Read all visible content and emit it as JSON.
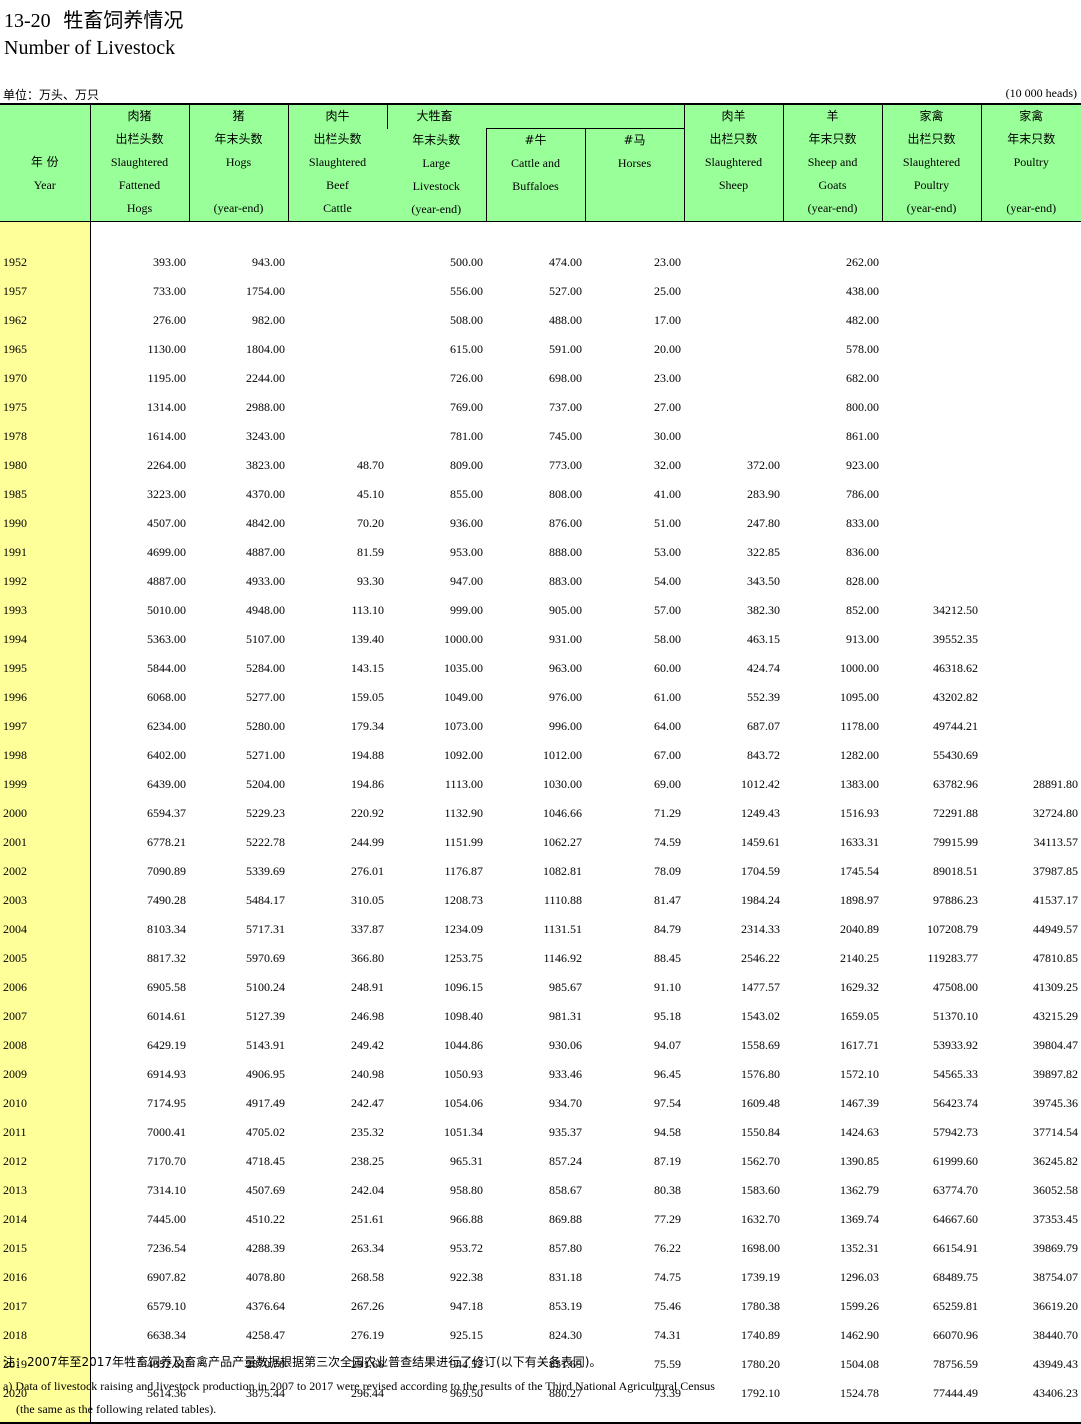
{
  "header": {
    "number": "13-20",
    "title_zh": "牲畜饲养情况",
    "title_en": "Number of Livestock",
    "unit_zh": "单位：万头、万只",
    "unit_en": "(10 000 heads)"
  },
  "columns": {
    "year": {
      "zh": "年 份",
      "en": "Year"
    },
    "fattened_hogs": {
      "zh1": "肉猪",
      "zh2": "出栏头数",
      "en1": "Slaughtered",
      "en2": "Fattened",
      "en3": "Hogs"
    },
    "hogs": {
      "zh1": "猪",
      "zh2": "年末头数",
      "en1": "Hogs",
      "en2": "",
      "en3": "(year-end)"
    },
    "beef": {
      "zh1": "肉牛",
      "zh2": "出栏头数",
      "en1": "Slaughtered",
      "en2": "Beef",
      "en3": "Cattle"
    },
    "large_livestock": {
      "zh1": "大牲畜",
      "zh2": "年末头数",
      "en1": "Large",
      "en2": "Livestock",
      "en3": "(year-end)"
    },
    "cattle": {
      "zh": "#牛",
      "en1": "Cattle and",
      "en2": "Buffaloes"
    },
    "horses": {
      "zh": "#马",
      "en1": "Horses"
    },
    "sheep_slaughtered": {
      "zh1": "肉羊",
      "zh2": "出栏只数",
      "en1": "Slaughtered",
      "en2": "Sheep",
      "en3": ""
    },
    "sheep_goats": {
      "zh1": "羊",
      "zh2": "年末只数",
      "en1": "Sheep and",
      "en2": "Goats",
      "en3": "(year-end)"
    },
    "poultry_slaughtered": {
      "zh1": "家禽",
      "zh2": "出栏只数",
      "en1": "Slaughtered",
      "en2": "Poultry",
      "en3": "(year-end)"
    },
    "poultry": {
      "zh1": "家禽",
      "zh2": "年末只数",
      "en1": "Poultry",
      "en2": "",
      "en3": "(year-end)"
    }
  },
  "rows": [
    [
      "1952",
      "393.00",
      "943.00",
      "",
      "500.00",
      "474.00",
      "23.00",
      "",
      "262.00",
      "",
      ""
    ],
    [
      "1957",
      "733.00",
      "1754.00",
      "",
      "556.00",
      "527.00",
      "25.00",
      "",
      "438.00",
      "",
      ""
    ],
    [
      "1962",
      "276.00",
      "982.00",
      "",
      "508.00",
      "488.00",
      "17.00",
      "",
      "482.00",
      "",
      ""
    ],
    [
      "1965",
      "1130.00",
      "1804.00",
      "",
      "615.00",
      "591.00",
      "20.00",
      "",
      "578.00",
      "",
      ""
    ],
    [
      "1970",
      "1195.00",
      "2244.00",
      "",
      "726.00",
      "698.00",
      "23.00",
      "",
      "682.00",
      "",
      ""
    ],
    [
      "1975",
      "1314.00",
      "2988.00",
      "",
      "769.00",
      "737.00",
      "27.00",
      "",
      "800.00",
      "",
      ""
    ],
    [
      "1978",
      "1614.00",
      "3243.00",
      "",
      "781.00",
      "745.00",
      "30.00",
      "",
      "861.00",
      "",
      ""
    ],
    [
      "1980",
      "2264.00",
      "3823.00",
      "48.70",
      "809.00",
      "773.00",
      "32.00",
      "372.00",
      "923.00",
      "",
      ""
    ],
    [
      "1985",
      "3223.00",
      "4370.00",
      "45.10",
      "855.00",
      "808.00",
      "41.00",
      "283.90",
      "786.00",
      "",
      ""
    ],
    [
      "1990",
      "4507.00",
      "4842.00",
      "70.20",
      "936.00",
      "876.00",
      "51.00",
      "247.80",
      "833.00",
      "",
      ""
    ],
    [
      "1991",
      "4699.00",
      "4887.00",
      "81.59",
      "953.00",
      "888.00",
      "53.00",
      "322.85",
      "836.00",
      "",
      ""
    ],
    [
      "1992",
      "4887.00",
      "4933.00",
      "93.30",
      "947.00",
      "883.00",
      "54.00",
      "343.50",
      "828.00",
      "",
      ""
    ],
    [
      "1993",
      "5010.00",
      "4948.00",
      "113.10",
      "999.00",
      "905.00",
      "57.00",
      "382.30",
      "852.00",
      "34212.50",
      ""
    ],
    [
      "1994",
      "5363.00",
      "5107.00",
      "139.40",
      "1000.00",
      "931.00",
      "58.00",
      "463.15",
      "913.00",
      "39552.35",
      ""
    ],
    [
      "1995",
      "5844.00",
      "5284.00",
      "143.15",
      "1035.00",
      "963.00",
      "60.00",
      "424.74",
      "1000.00",
      "46318.62",
      ""
    ],
    [
      "1996",
      "6068.00",
      "5277.00",
      "159.05",
      "1049.00",
      "976.00",
      "61.00",
      "552.39",
      "1095.00",
      "43202.82",
      ""
    ],
    [
      "1997",
      "6234.00",
      "5280.00",
      "179.34",
      "1073.00",
      "996.00",
      "64.00",
      "687.07",
      "1178.00",
      "49744.21",
      ""
    ],
    [
      "1998",
      "6402.00",
      "5271.00",
      "194.88",
      "1092.00",
      "1012.00",
      "67.00",
      "843.72",
      "1282.00",
      "55430.69",
      ""
    ],
    [
      "1999",
      "6439.00",
      "5204.00",
      "194.86",
      "1113.00",
      "1030.00",
      "69.00",
      "1012.42",
      "1383.00",
      "63782.96",
      "28891.80"
    ],
    [
      "2000",
      "6594.37",
      "5229.23",
      "220.92",
      "1132.90",
      "1046.66",
      "71.29",
      "1249.43",
      "1516.93",
      "72291.88",
      "32724.80"
    ],
    [
      "2001",
      "6778.21",
      "5222.78",
      "244.99",
      "1151.99",
      "1062.27",
      "74.59",
      "1459.61",
      "1633.31",
      "79915.99",
      "34113.57"
    ],
    [
      "2002",
      "7090.89",
      "5339.69",
      "276.01",
      "1176.87",
      "1082.81",
      "78.09",
      "1704.59",
      "1745.54",
      "89018.51",
      "37987.85"
    ],
    [
      "2003",
      "7490.28",
      "5484.17",
      "310.05",
      "1208.73",
      "1110.88",
      "81.47",
      "1984.24",
      "1898.97",
      "97886.23",
      "41537.17"
    ],
    [
      "2004",
      "8103.34",
      "5717.31",
      "337.87",
      "1234.09",
      "1131.51",
      "84.79",
      "2314.33",
      "2040.89",
      "107208.79",
      "44949.57"
    ],
    [
      "2005",
      "8817.32",
      "5970.69",
      "366.80",
      "1253.75",
      "1146.92",
      "88.45",
      "2546.22",
      "2140.25",
      "119283.77",
      "47810.85"
    ],
    [
      "2006",
      "6905.58",
      "5100.24",
      "248.91",
      "1096.15",
      "985.67",
      "91.10",
      "1477.57",
      "1629.32",
      "47508.00",
      "41309.25"
    ],
    [
      "2007",
      "6014.61",
      "5127.39",
      "246.98",
      "1098.40",
      "981.31",
      "95.18",
      "1543.02",
      "1659.05",
      "51370.10",
      "43215.29"
    ],
    [
      "2008",
      "6429.19",
      "5143.91",
      "249.42",
      "1044.86",
      "930.06",
      "94.07",
      "1558.69",
      "1617.71",
      "53933.92",
      "39804.47"
    ],
    [
      "2009",
      "6914.93",
      "4906.95",
      "240.98",
      "1050.93",
      "933.46",
      "96.45",
      "1576.80",
      "1572.10",
      "54565.33",
      "39897.82"
    ],
    [
      "2010",
      "7174.95",
      "4917.49",
      "242.47",
      "1054.06",
      "934.70",
      "97.54",
      "1609.48",
      "1467.39",
      "56423.74",
      "39745.36"
    ],
    [
      "2011",
      "7000.41",
      "4705.02",
      "235.32",
      "1051.34",
      "935.37",
      "94.58",
      "1550.84",
      "1424.63",
      "57942.73",
      "37714.54"
    ],
    [
      "2012",
      "7170.70",
      "4718.45",
      "238.25",
      "965.31",
      "857.24",
      "87.19",
      "1562.70",
      "1390.85",
      "61999.60",
      "36245.82"
    ],
    [
      "2013",
      "7314.10",
      "4507.69",
      "242.04",
      "958.80",
      "858.67",
      "80.38",
      "1583.60",
      "1362.79",
      "63774.70",
      "36052.58"
    ],
    [
      "2014",
      "7445.00",
      "4510.22",
      "251.61",
      "966.88",
      "869.88",
      "77.29",
      "1632.70",
      "1369.74",
      "64667.60",
      "37353.45"
    ],
    [
      "2015",
      "7236.54",
      "4288.39",
      "263.34",
      "953.72",
      "857.80",
      "76.22",
      "1698.00",
      "1352.31",
      "66154.91",
      "39869.79"
    ],
    [
      "2016",
      "6907.82",
      "4078.80",
      "268.58",
      "922.38",
      "831.18",
      "74.75",
      "1739.19",
      "1296.03",
      "68489.75",
      "38754.07"
    ],
    [
      "2017",
      "6579.10",
      "4376.64",
      "267.26",
      "947.18",
      "853.19",
      "75.46",
      "1780.38",
      "1599.26",
      "65259.81",
      "36619.20"
    ],
    [
      "2018",
      "6638.34",
      "4258.47",
      "276.19",
      "925.15",
      "824.30",
      "74.31",
      "1740.89",
      "1462.90",
      "66070.96",
      "38440.70"
    ],
    [
      "2019",
      "4852.61",
      "2870.70",
      "291.66",
      "944.52",
      "851.65",
      "75.59",
      "1780.20",
      "1504.08",
      "78756.59",
      "43949.43"
    ],
    [
      "2020",
      "5614.36",
      "3875.44",
      "296.44",
      "969.50",
      "880.27",
      "73.39",
      "1792.10",
      "1524.78",
      "77444.49",
      "43406.23"
    ]
  ],
  "notes": {
    "zh": "注：2007年至2017年牲畜饲养及畜禽产品产量数据根据第三次全国农业普查结果进行了修订(以下有关各表同)。",
    "en1": "a) Data of livestock raising and livestock production in 2007 to 2017 were revised according to the results of the Third National Agricultural Census",
    "en2": "(the same as the following related tables)."
  }
}
